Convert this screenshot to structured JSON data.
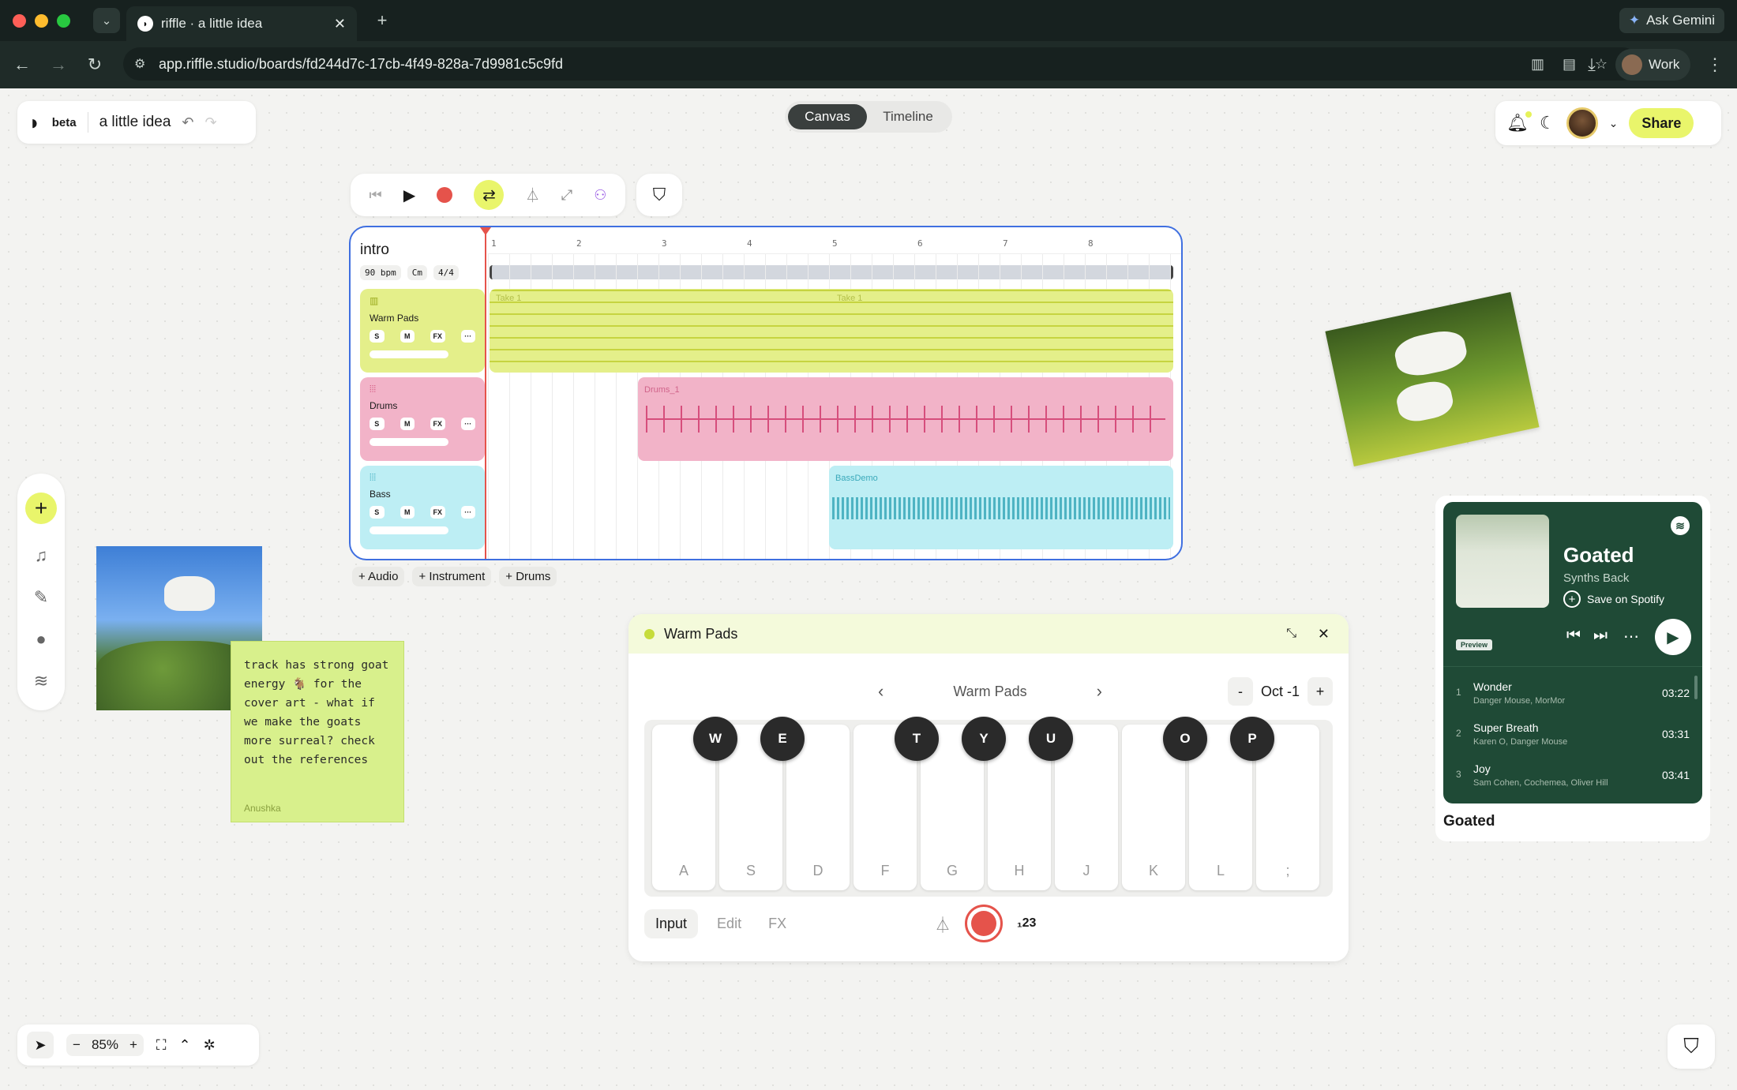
{
  "browser": {
    "tab_title": "riffle · a little idea",
    "url": "app.riffle.studio/boards/fd244d7c-17cb-4f49-828a-7d9981c5c9fd",
    "ask_gemini": "Ask Gemini",
    "profile": "Work"
  },
  "header": {
    "beta": "beta",
    "board_name": "a little idea",
    "view_tabs": [
      "Canvas",
      "Timeline"
    ],
    "share": "Share"
  },
  "daw": {
    "section_name": "intro",
    "bpm": "90 bpm",
    "key": "Cm",
    "meter": "4/4",
    "bars": [
      "1",
      "2",
      "3",
      "4",
      "5",
      "6",
      "7",
      "8"
    ],
    "tracks": [
      {
        "name": "Warm Pads",
        "color": "#e4ef8a",
        "clip_labels": [
          "Take 1",
          "Take 1"
        ]
      },
      {
        "name": "Drums",
        "color": "#f2b3c8",
        "clip_labels": [
          "Drums_1"
        ]
      },
      {
        "name": "Bass",
        "color": "#bdeef4",
        "clip_labels": [
          "BassDemo"
        ]
      }
    ],
    "track_buttons": [
      "S",
      "M",
      "FX",
      "···"
    ],
    "add_buttons": [
      "+ Audio",
      "+ Instrument",
      "+ Drums"
    ]
  },
  "note": {
    "text": "track has strong goat energy 🐐 for the cover art - what if we make the goats more surreal? check out the references",
    "author": "Anushka"
  },
  "keyboard": {
    "title": "Warm Pads",
    "preset": "Warm Pads",
    "octave": "Oct -1",
    "minus": "-",
    "plus": "+",
    "white_keys": [
      "A",
      "S",
      "D",
      "F",
      "G",
      "H",
      "J",
      "K",
      "L",
      ";"
    ],
    "black_keys": [
      "W",
      "E",
      "T",
      "Y",
      "U",
      "O",
      "P"
    ],
    "tabs": [
      "Input",
      "Edit",
      "FX"
    ],
    "numeric": "₁23"
  },
  "spotify": {
    "album": "Goated",
    "artist": "Synths Back",
    "save": "Save on Spotify",
    "preview": "Preview",
    "tracks": [
      {
        "num": "1",
        "title": "Wonder",
        "artists": "Danger Mouse, MorMor",
        "time": "03:22"
      },
      {
        "num": "2",
        "title": "Super Breath",
        "artists": "Karen O, Danger Mouse",
        "time": "03:31"
      },
      {
        "num": "3",
        "title": "Joy",
        "artists": "Sam Cohen, Cochemea, Oliver Hill",
        "time": "03:41"
      }
    ],
    "caption": "Goated"
  },
  "zoom": {
    "level": "85%",
    "minus": "−",
    "plus": "+"
  }
}
